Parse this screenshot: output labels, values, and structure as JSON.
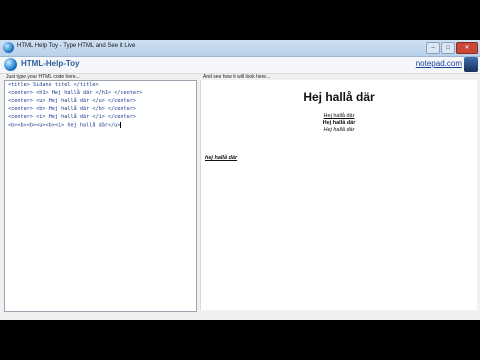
{
  "window": {
    "title": "HTML Help Toy - Type HTML and See it Live",
    "controls": {
      "minimize": "–",
      "maximize": "□",
      "close": "✕"
    }
  },
  "header": {
    "app_name": "HTML-Help-Toy",
    "link": "notepad.com"
  },
  "editor": {
    "label": "Just type your HTML code here...",
    "lines": [
      "<title> Sidans titel </title>",
      "<center> <h1> Hej hallå där </h1> </center>",
      "<center> <u> Hej hallå där </u> </center>",
      "<center> <b> Hej hallå där </b> </center>",
      "<center> <i> Hej hallå där </i> </center>",
      "<b><b><b><u><b><i> hej hallå där</u>"
    ]
  },
  "preview": {
    "label": "And see how it will look here...",
    "h1": "Hej hallå där",
    "underline": "Hej hallå där",
    "bold": "Hej hallå där",
    "italic": "Hej hallå där",
    "last": "hej hallå där"
  },
  "colors": {
    "code_text": "#1c3a8c",
    "logo_text": "#2d5c9a",
    "link": "#1a3fa0",
    "close_button": "#c9483a"
  },
  "icons": [
    "globe-icon",
    "app-icon",
    "user-avatar-icon"
  ]
}
